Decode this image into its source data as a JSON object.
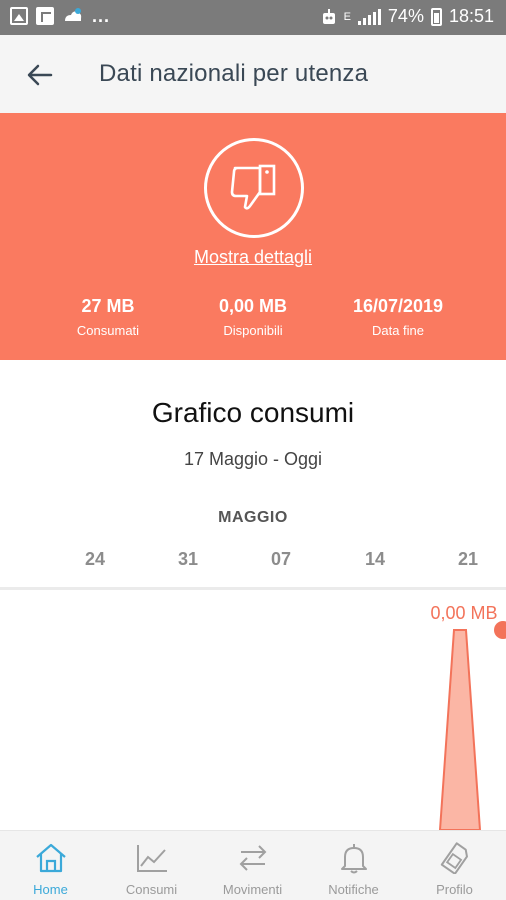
{
  "status_bar": {
    "dots": "...",
    "network": "E",
    "battery_percent": "74%",
    "time": "18:51"
  },
  "header": {
    "title": "Dati nazionali per utenza",
    "back_icon": "arrow-left-icon"
  },
  "hero": {
    "icon": "thumbs-down-icon",
    "details_link": "Mostra dettagli",
    "background_color": "#fa7a60",
    "stats": [
      {
        "value": "27 MB",
        "label": "Consumati"
      },
      {
        "value": "0,00 MB",
        "label": "Disponibili"
      },
      {
        "value": "16/07/2019",
        "label": "Data fine"
      }
    ]
  },
  "chart": {
    "title": "Grafico consumi",
    "subtitle": "17 Maggio - Oggi",
    "month": "MAGGIO",
    "ticks": [
      "24",
      "31",
      "07",
      "14",
      "21"
    ],
    "peak_label": "0,00 MB",
    "accent_color": "#f3735a"
  },
  "chart_data": {
    "type": "area",
    "title": "Grafico consumi",
    "x": [
      "24",
      "31",
      "07",
      "14",
      "21"
    ],
    "series": [
      {
        "values": [
          0,
          0,
          0,
          0,
          0
        ]
      }
    ],
    "annotations": [
      "0,00 MB"
    ]
  },
  "bottom_nav": {
    "active_color": "#3ba9d9",
    "items": [
      {
        "label": "Home",
        "icon": "home-icon",
        "active": true
      },
      {
        "label": "Consumi",
        "icon": "line-chart-icon",
        "active": false
      },
      {
        "label": "Movimenti",
        "icon": "swap-arrows-icon",
        "active": false
      },
      {
        "label": "Notifiche",
        "icon": "bell-icon",
        "active": false
      },
      {
        "label": "Profilo",
        "icon": "sim-card-icon",
        "active": false
      }
    ]
  }
}
